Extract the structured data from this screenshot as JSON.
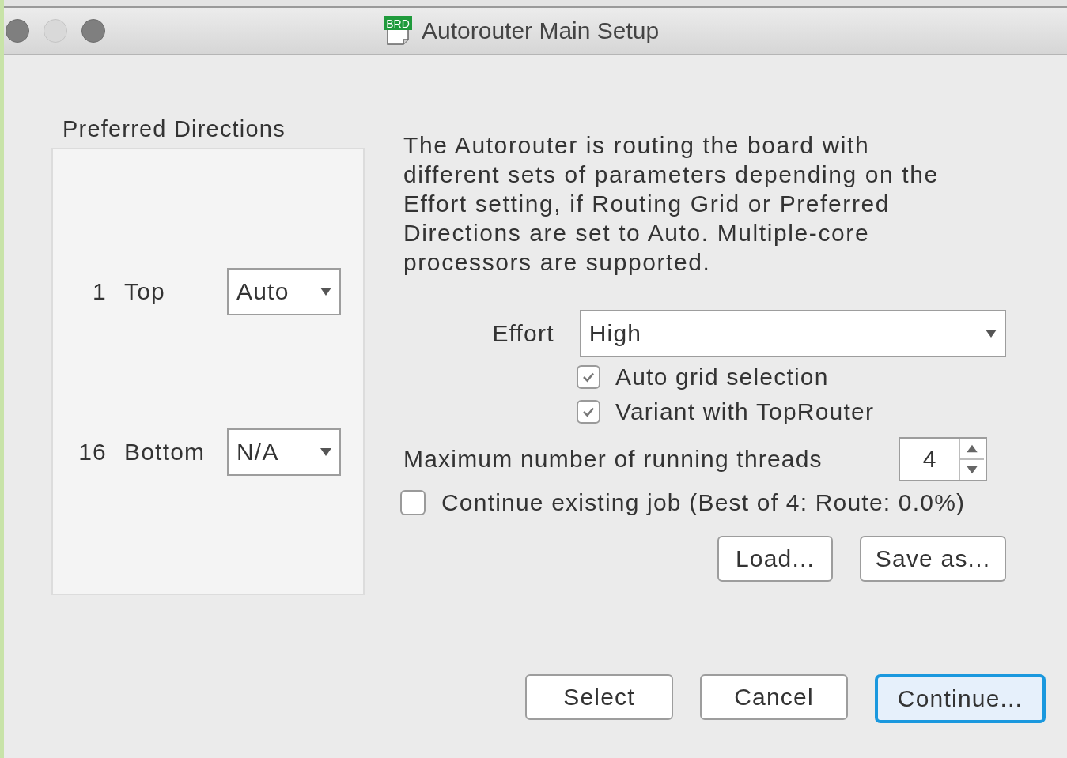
{
  "window": {
    "title": "Autorouter Main Setup",
    "icon_label": "BRD"
  },
  "preferred_directions": {
    "title": "Preferred Directions",
    "layers": [
      {
        "number": "1",
        "name": "Top",
        "direction": "Auto"
      },
      {
        "number": "16",
        "name": "Bottom",
        "direction": "N/A"
      }
    ]
  },
  "description": "The Autorouter is routing the board with different sets of parameters depending on the Effort setting, if Routing Grid or Preferred Directions are set to Auto. Multiple-core processors are supported.",
  "effort": {
    "label": "Effort",
    "value": "High"
  },
  "options": [
    {
      "label": "Auto grid selection",
      "checked": true
    },
    {
      "label": "Variant with TopRouter",
      "checked": true
    }
  ],
  "threads": {
    "label": "Maximum number of running threads",
    "value": "4"
  },
  "continue_job": {
    "label": "Continue existing job (Best of 4: Route: 0.0%)",
    "checked": false
  },
  "file_buttons": [
    "Load...",
    "Save as..."
  ],
  "buttons": [
    {
      "label": "Select",
      "default": false
    },
    {
      "label": "Cancel",
      "default": false
    },
    {
      "label": "Continue...",
      "default": true
    }
  ]
}
